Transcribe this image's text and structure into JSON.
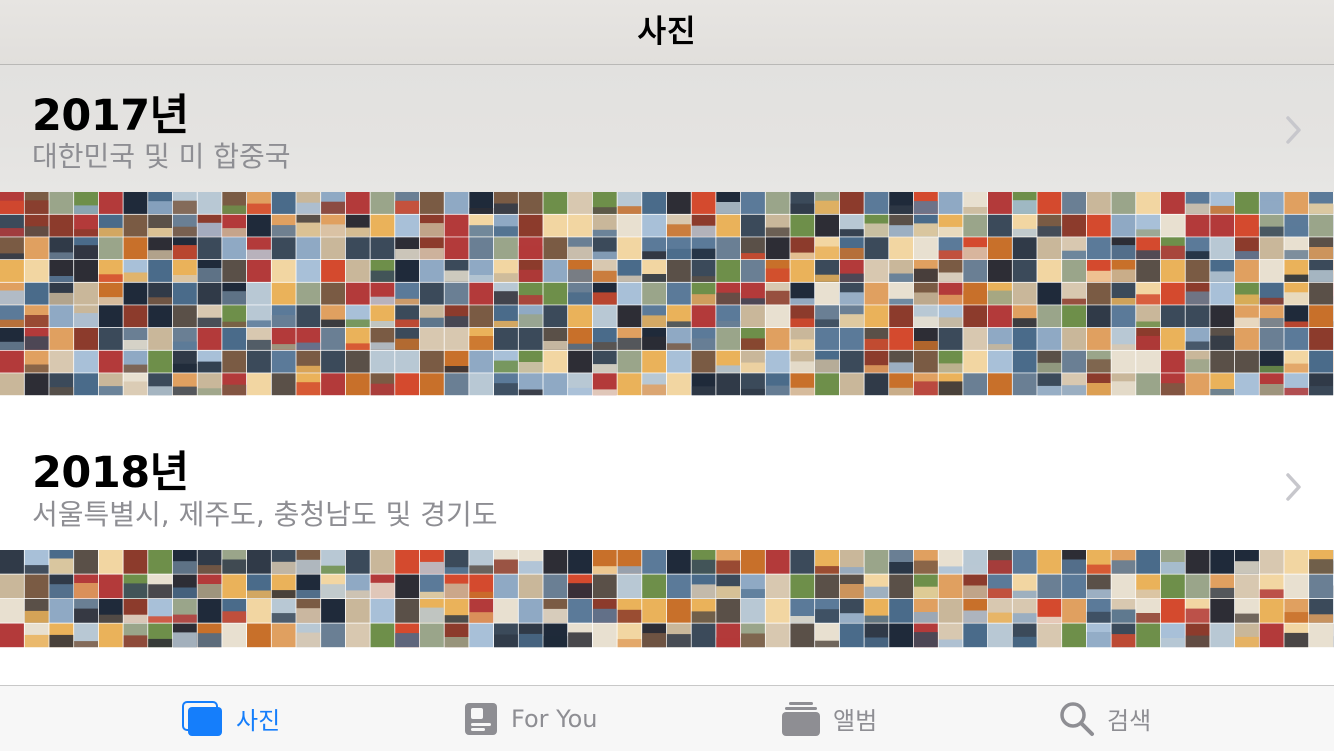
{
  "nav": {
    "title": "사진"
  },
  "sections": [
    {
      "year": "2017년",
      "places": "대한민국 및 미 합중국"
    },
    {
      "year": "2018년",
      "places": "서울특별시, 제주도, 충청남도 및 경기도"
    }
  ],
  "tabs": [
    {
      "label": "사진",
      "icon": "photos-icon",
      "active": true
    },
    {
      "label": "For You",
      "icon": "for-you-icon",
      "active": false
    },
    {
      "label": "앨범",
      "icon": "albums-icon",
      "active": false
    },
    {
      "label": "검색",
      "icon": "search-icon",
      "active": false
    }
  ],
  "colors": {
    "accent": "#157efb",
    "inactive": "#8e8e93",
    "subtitle": "#8e8e93"
  }
}
